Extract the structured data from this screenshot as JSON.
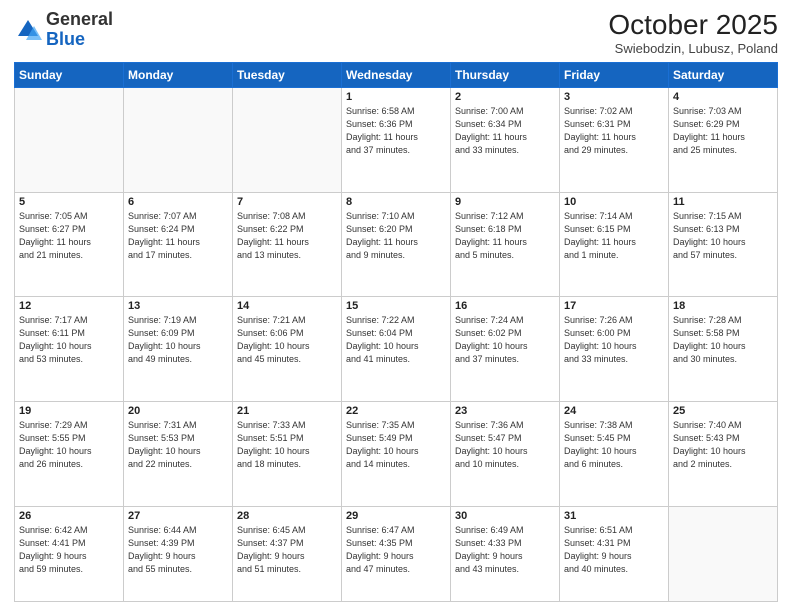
{
  "logo": {
    "general": "General",
    "blue": "Blue"
  },
  "header": {
    "month": "October 2025",
    "location": "Swiebodzin, Lubusz, Poland"
  },
  "weekdays": [
    "Sunday",
    "Monday",
    "Tuesday",
    "Wednesday",
    "Thursday",
    "Friday",
    "Saturday"
  ],
  "weeks": [
    [
      {
        "day": "",
        "content": ""
      },
      {
        "day": "",
        "content": ""
      },
      {
        "day": "",
        "content": ""
      },
      {
        "day": "1",
        "content": "Sunrise: 6:58 AM\nSunset: 6:36 PM\nDaylight: 11 hours\nand 37 minutes."
      },
      {
        "day": "2",
        "content": "Sunrise: 7:00 AM\nSunset: 6:34 PM\nDaylight: 11 hours\nand 33 minutes."
      },
      {
        "day": "3",
        "content": "Sunrise: 7:02 AM\nSunset: 6:31 PM\nDaylight: 11 hours\nand 29 minutes."
      },
      {
        "day": "4",
        "content": "Sunrise: 7:03 AM\nSunset: 6:29 PM\nDaylight: 11 hours\nand 25 minutes."
      }
    ],
    [
      {
        "day": "5",
        "content": "Sunrise: 7:05 AM\nSunset: 6:27 PM\nDaylight: 11 hours\nand 21 minutes."
      },
      {
        "day": "6",
        "content": "Sunrise: 7:07 AM\nSunset: 6:24 PM\nDaylight: 11 hours\nand 17 minutes."
      },
      {
        "day": "7",
        "content": "Sunrise: 7:08 AM\nSunset: 6:22 PM\nDaylight: 11 hours\nand 13 minutes."
      },
      {
        "day": "8",
        "content": "Sunrise: 7:10 AM\nSunset: 6:20 PM\nDaylight: 11 hours\nand 9 minutes."
      },
      {
        "day": "9",
        "content": "Sunrise: 7:12 AM\nSunset: 6:18 PM\nDaylight: 11 hours\nand 5 minutes."
      },
      {
        "day": "10",
        "content": "Sunrise: 7:14 AM\nSunset: 6:15 PM\nDaylight: 11 hours\nand 1 minute."
      },
      {
        "day": "11",
        "content": "Sunrise: 7:15 AM\nSunset: 6:13 PM\nDaylight: 10 hours\nand 57 minutes."
      }
    ],
    [
      {
        "day": "12",
        "content": "Sunrise: 7:17 AM\nSunset: 6:11 PM\nDaylight: 10 hours\nand 53 minutes."
      },
      {
        "day": "13",
        "content": "Sunrise: 7:19 AM\nSunset: 6:09 PM\nDaylight: 10 hours\nand 49 minutes."
      },
      {
        "day": "14",
        "content": "Sunrise: 7:21 AM\nSunset: 6:06 PM\nDaylight: 10 hours\nand 45 minutes."
      },
      {
        "day": "15",
        "content": "Sunrise: 7:22 AM\nSunset: 6:04 PM\nDaylight: 10 hours\nand 41 minutes."
      },
      {
        "day": "16",
        "content": "Sunrise: 7:24 AM\nSunset: 6:02 PM\nDaylight: 10 hours\nand 37 minutes."
      },
      {
        "day": "17",
        "content": "Sunrise: 7:26 AM\nSunset: 6:00 PM\nDaylight: 10 hours\nand 33 minutes."
      },
      {
        "day": "18",
        "content": "Sunrise: 7:28 AM\nSunset: 5:58 PM\nDaylight: 10 hours\nand 30 minutes."
      }
    ],
    [
      {
        "day": "19",
        "content": "Sunrise: 7:29 AM\nSunset: 5:55 PM\nDaylight: 10 hours\nand 26 minutes."
      },
      {
        "day": "20",
        "content": "Sunrise: 7:31 AM\nSunset: 5:53 PM\nDaylight: 10 hours\nand 22 minutes."
      },
      {
        "day": "21",
        "content": "Sunrise: 7:33 AM\nSunset: 5:51 PM\nDaylight: 10 hours\nand 18 minutes."
      },
      {
        "day": "22",
        "content": "Sunrise: 7:35 AM\nSunset: 5:49 PM\nDaylight: 10 hours\nand 14 minutes."
      },
      {
        "day": "23",
        "content": "Sunrise: 7:36 AM\nSunset: 5:47 PM\nDaylight: 10 hours\nand 10 minutes."
      },
      {
        "day": "24",
        "content": "Sunrise: 7:38 AM\nSunset: 5:45 PM\nDaylight: 10 hours\nand 6 minutes."
      },
      {
        "day": "25",
        "content": "Sunrise: 7:40 AM\nSunset: 5:43 PM\nDaylight: 10 hours\nand 2 minutes."
      }
    ],
    [
      {
        "day": "26",
        "content": "Sunrise: 6:42 AM\nSunset: 4:41 PM\nDaylight: 9 hours\nand 59 minutes."
      },
      {
        "day": "27",
        "content": "Sunrise: 6:44 AM\nSunset: 4:39 PM\nDaylight: 9 hours\nand 55 minutes."
      },
      {
        "day": "28",
        "content": "Sunrise: 6:45 AM\nSunset: 4:37 PM\nDaylight: 9 hours\nand 51 minutes."
      },
      {
        "day": "29",
        "content": "Sunrise: 6:47 AM\nSunset: 4:35 PM\nDaylight: 9 hours\nand 47 minutes."
      },
      {
        "day": "30",
        "content": "Sunrise: 6:49 AM\nSunset: 4:33 PM\nDaylight: 9 hours\nand 43 minutes."
      },
      {
        "day": "31",
        "content": "Sunrise: 6:51 AM\nSunset: 4:31 PM\nDaylight: 9 hours\nand 40 minutes."
      },
      {
        "day": "",
        "content": ""
      }
    ]
  ]
}
